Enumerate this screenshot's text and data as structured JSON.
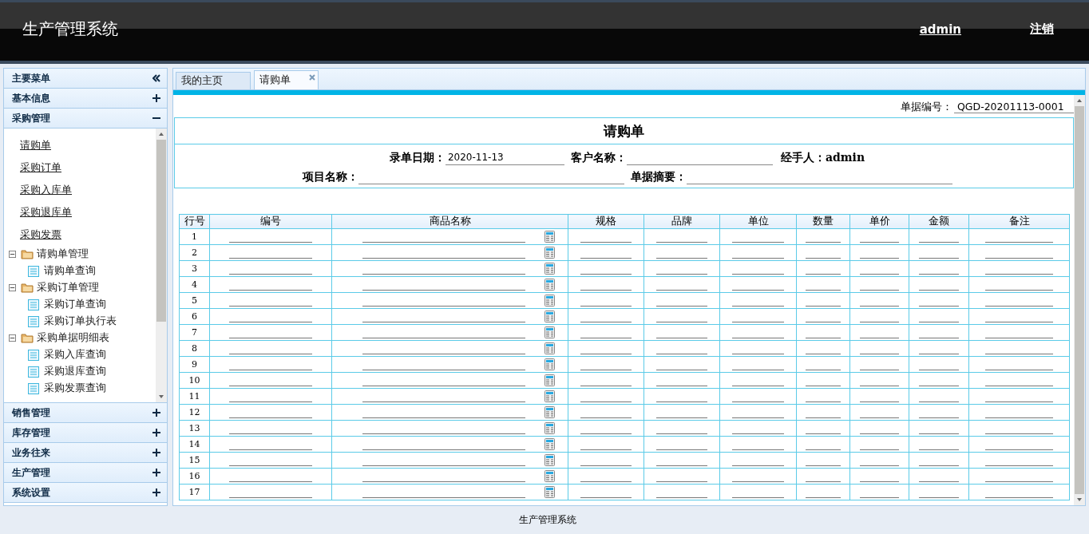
{
  "header": {
    "title": "生产管理系统",
    "user_link": "admin",
    "logout_link": "注销"
  },
  "sidebar": {
    "title": "主要菜单",
    "panels": [
      {
        "label": "基本信息",
        "expanded": false
      },
      {
        "label": "采购管理",
        "expanded": true,
        "links": [
          "请购单",
          "采购订单",
          "采购入库单",
          "采购退库单",
          "采购发票"
        ],
        "tree": [
          {
            "label": "请购单管理",
            "expanded": true,
            "children": [
              {
                "label": "请购单查询"
              }
            ]
          },
          {
            "label": "采购订单管理",
            "expanded": true,
            "children": [
              {
                "label": "采购订单查询"
              },
              {
                "label": "采购订单执行表"
              }
            ]
          },
          {
            "label": "采购单据明细表",
            "expanded": true,
            "children": [
              {
                "label": "采购入库查询"
              },
              {
                "label": "采购退库查询"
              },
              {
                "label": "采购发票查询"
              }
            ]
          }
        ]
      },
      {
        "label": "销售管理",
        "expanded": false
      },
      {
        "label": "库存管理",
        "expanded": false
      },
      {
        "label": "业务往来",
        "expanded": false
      },
      {
        "label": "生产管理",
        "expanded": false
      },
      {
        "label": "系统设置",
        "expanded": false
      }
    ]
  },
  "tabs": [
    {
      "label": "我的主页",
      "selected": false,
      "closable": false
    },
    {
      "label": "请购单",
      "selected": true,
      "closable": true
    }
  ],
  "form": {
    "doc_no_label": "单据编号：",
    "doc_no": "QGD-20201113-0001",
    "title": "请购单",
    "field_rows": [
      [
        {
          "kind": "field",
          "label": "录单日期：",
          "value": "2020-11-13"
        },
        {
          "kind": "field",
          "label": "客户名称："
        },
        {
          "kind": "text",
          "label": "经手人：",
          "value": "admin"
        }
      ],
      [
        {
          "kind": "field",
          "label": "项目名称：",
          "wide": true
        },
        {
          "kind": "field",
          "label": "单据摘要：",
          "wide": true
        }
      ]
    ]
  },
  "table": {
    "columns": [
      {
        "label": "行号",
        "kind": "line"
      },
      {
        "label": "编号",
        "kind": "input"
      },
      {
        "label": "商品名称",
        "kind": "lookup"
      },
      {
        "label": "规格",
        "kind": "input"
      },
      {
        "label": "品牌",
        "kind": "input"
      },
      {
        "label": "单位",
        "kind": "input"
      },
      {
        "label": "数量",
        "kind": "input"
      },
      {
        "label": "单价",
        "kind": "input"
      },
      {
        "label": "金额",
        "kind": "input"
      },
      {
        "label": "备注",
        "kind": "input"
      }
    ],
    "rows": [
      "1",
      "2",
      "3",
      "4",
      "5",
      "6",
      "7",
      "8",
      "9",
      "10",
      "11",
      "12",
      "13",
      "14",
      "15",
      "16",
      "17"
    ]
  },
  "footer": {
    "text": "生产管理系统"
  }
}
